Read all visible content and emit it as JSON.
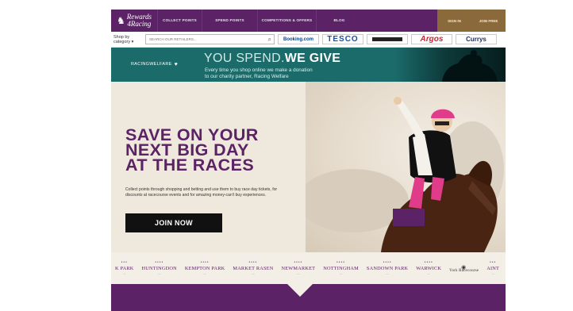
{
  "nav": {
    "logo_line1": "Rewards",
    "logo_line2": "4Racing",
    "items": [
      "COLLECT POINTS",
      "SPEND POINTS",
      "COMPETITIONS & OFFERS",
      "BLOG"
    ],
    "sign_in": "SIGN IN",
    "join_free": "JOIN FREE"
  },
  "search": {
    "shop_by": "Shop by category ▾",
    "placeholder": "SEARCH OUR RETAILERS...",
    "retailers": [
      "Booking.com",
      "TESCO",
      "",
      "Argos",
      "Currys"
    ]
  },
  "charity": {
    "partner": "RACINGWELFARE",
    "headline_a": "YOU SPEND.",
    "headline_b": "WE GIVE",
    "line1": "Every time you shop online we make a donation",
    "line2": "to our charity partner, Racing Welfare"
  },
  "hero": {
    "title": [
      "SAVE ON YOUR",
      "NEXT BIG DAY",
      "AT THE RACES"
    ],
    "description": "Collect points through shopping and betting and use them to buy race day tickets, for discounts at racecourse events and for amazing money-can't buy experiences.",
    "cta": "JOIN NOW"
  },
  "courses": [
    "K PARK",
    "HUNTINGDON",
    "KEMPTON PARK",
    "MARKET RASEN",
    "NEWMARKET",
    "NOTTINGHAM",
    "SANDOWN PARK",
    "WARWICK",
    "York Racecourse",
    "AINT"
  ],
  "colors": {
    "brand": "#5b2266",
    "teal": "#1b6b6b",
    "gold": "#8a6a3a"
  }
}
